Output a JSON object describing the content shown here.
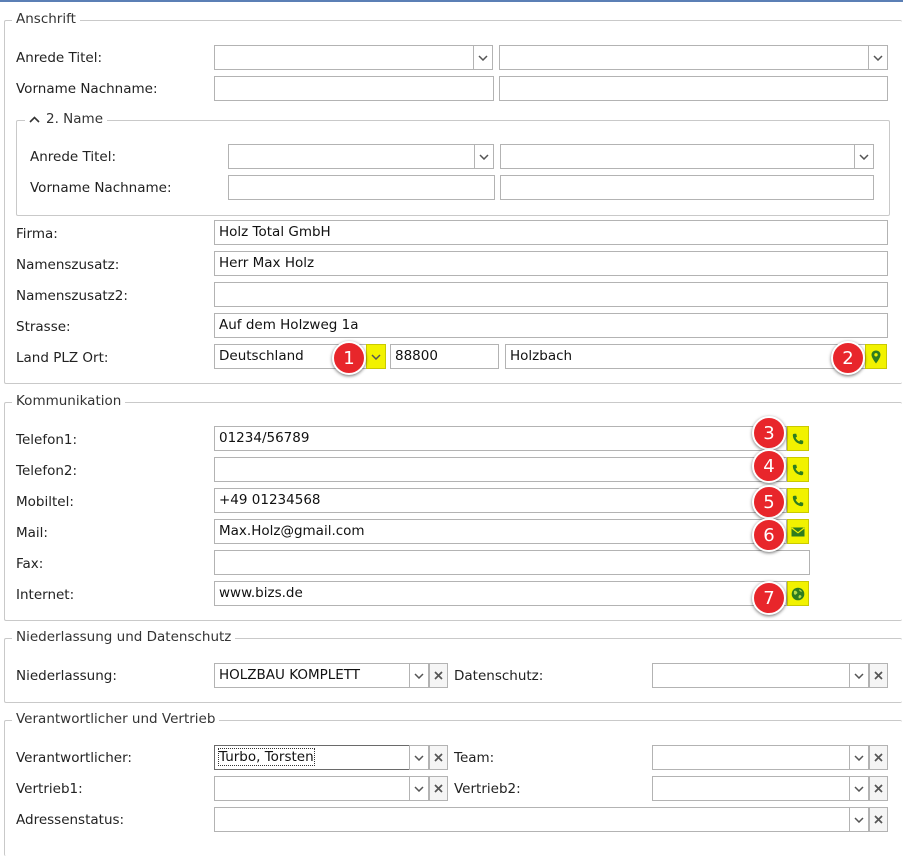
{
  "anschrift": {
    "legend": "Anschrift",
    "anrede_titel_label": "Anrede Titel:",
    "vorname_nachname_label": "Vorname Nachname:",
    "anrede": "",
    "titel": "",
    "vorname": "",
    "nachname": "",
    "second_name": {
      "legend": "2. Name",
      "anrede_titel_label": "Anrede Titel:",
      "vorname_nachname_label": "Vorname Nachname:",
      "anrede": "",
      "titel": "",
      "vorname": "",
      "nachname": ""
    },
    "firma_label": "Firma:",
    "firma": "Holz Total GmbH",
    "namenszusatz_label": "Namenszusatz:",
    "namenszusatz": "Herr Max Holz",
    "namenszusatz2_label": "Namenszusatz2:",
    "namenszusatz2": "",
    "strasse_label": "Strasse:",
    "strasse": "Auf dem Holzweg 1a",
    "land_plz_ort_label": "Land PLZ Ort:",
    "land": "Deutschland",
    "plz": "88800",
    "ort": "Holzbach"
  },
  "kommunikation": {
    "legend": "Kommunikation",
    "telefon1_label": "Telefon1:",
    "telefon1": "01234/56789",
    "telefon2_label": "Telefon2:",
    "telefon2": "",
    "mobiltel_label": "Mobiltel:",
    "mobiltel": "+49 01234568",
    "mail_label": "Mail:",
    "mail": "Max.Holz@gmail.com",
    "fax_label": "Fax:",
    "fax": "",
    "internet_label": "Internet:",
    "internet": "www.bizs.de"
  },
  "niederlassung": {
    "legend": "Niederlassung und Datenschutz",
    "niederlassung_label": "Niederlassung:",
    "niederlassung": "HOLZBAU KOMPLETT",
    "datenschutz_label": "Datenschutz:",
    "datenschutz": ""
  },
  "vertrieb": {
    "legend": "Verantwortlicher und Vertrieb",
    "verantwortlicher_label": "Verantwortlicher:",
    "verantwortlicher": "Turbo, Torsten",
    "team_label": "Team:",
    "team": "",
    "vertrieb1_label": "Vertrieb1:",
    "vertrieb1": "",
    "vertrieb2_label": "Vertrieb2:",
    "vertrieb2": "",
    "adressenstatus_label": "Adressenstatus:",
    "adressenstatus": ""
  },
  "badges": [
    "1",
    "2",
    "3",
    "4",
    "5",
    "6",
    "7"
  ],
  "icons": {
    "dropdown": "chevron-down-icon",
    "clear": "clear-x-icon",
    "collapse": "chevron-up-icon",
    "map": "map-pin-icon",
    "phone": "phone-icon",
    "mail": "envelope-icon",
    "internet": "globe-icon"
  },
  "colors": {
    "highlight": "#f2f200",
    "badge": "#e8262b",
    "action_icon": "#2e7d1f",
    "border": "#b3b3b3"
  }
}
